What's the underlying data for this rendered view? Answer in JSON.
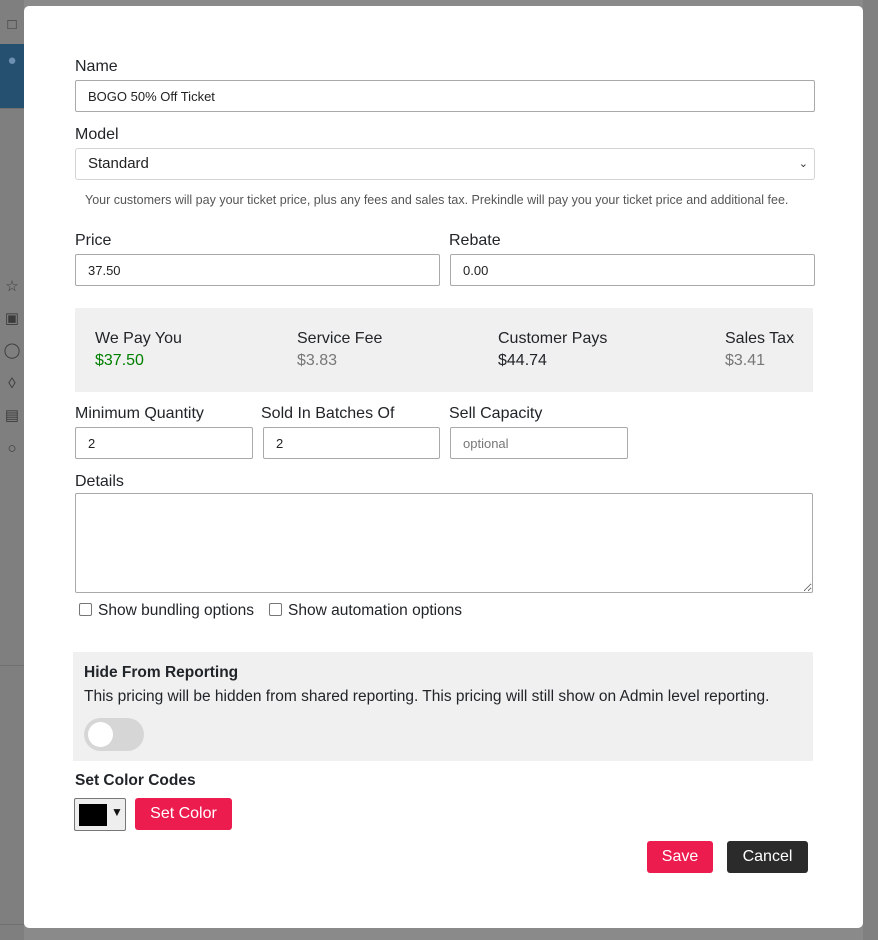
{
  "form": {
    "name_label": "Name",
    "name_value": "BOGO 50% Off Ticket",
    "model_label": "Model",
    "model_value": "Standard",
    "model_help": "Your customers will pay your ticket price, plus any fees and sales tax. Prekindle will pay you your ticket price and additional fee.",
    "price_label": "Price",
    "price_value": "37.50",
    "rebate_label": "Rebate",
    "rebate_value": "0.00",
    "min_qty_label": "Minimum Quantity",
    "min_qty_value": "2",
    "batches_label": "Sold In Batches Of",
    "batches_value": "2",
    "capacity_label": "Sell Capacity",
    "capacity_placeholder": "optional",
    "details_label": "Details",
    "details_value": "",
    "bundling_label": "Show bundling options",
    "automation_label": "Show automation options"
  },
  "summary": {
    "we_pay_label": "We Pay You",
    "we_pay_value": "$37.50",
    "service_fee_label": "Service Fee",
    "service_fee_value": "$3.83",
    "customer_pays_label": "Customer Pays",
    "customer_pays_value": "$44.74",
    "sales_tax_label": "Sales Tax",
    "sales_tax_value": "$3.41"
  },
  "hide_reporting": {
    "title": "Hide From Reporting",
    "description": "This pricing will be hidden from shared reporting. This pricing will still show on Admin level reporting.",
    "enabled": false
  },
  "colors": {
    "title": "Set Color Codes",
    "selected_color": "#000000",
    "set_color_label": "Set Color"
  },
  "actions": {
    "save_label": "Save",
    "cancel_label": "Cancel"
  },
  "theme": {
    "accent": "#ec1c4e",
    "positive": "#008000",
    "muted": "#777777"
  }
}
